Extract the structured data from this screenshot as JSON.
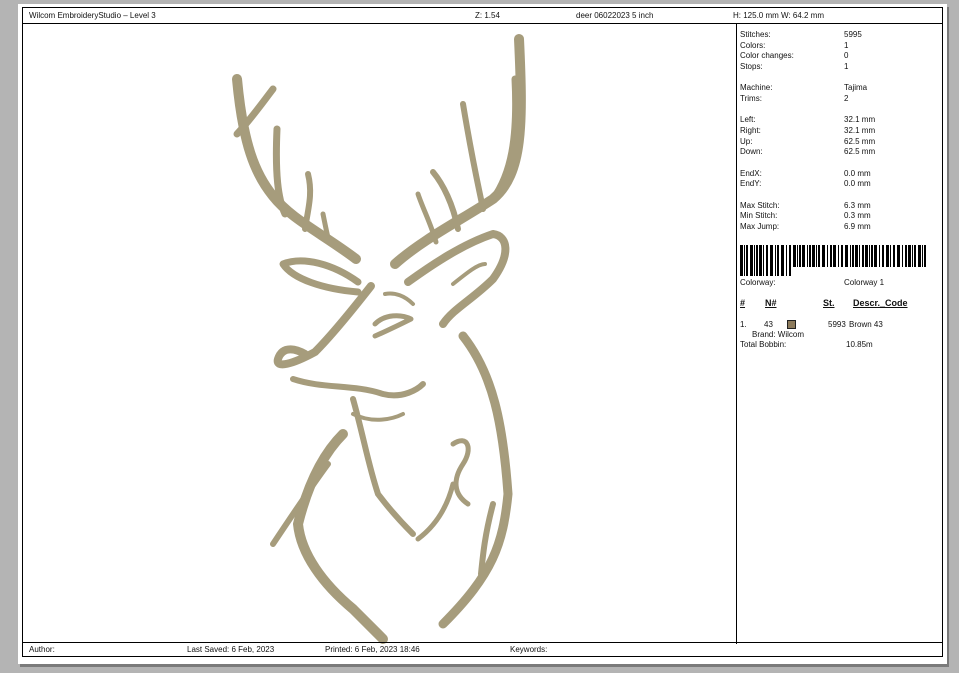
{
  "header": {
    "app_title": "Wilcom EmbroideryStudio – Level 3",
    "zoom": "Z: 1.54",
    "file_name": "deer 06022023 5 inch",
    "dimensions": "H: 125.0 mm   W: 64.2 mm"
  },
  "stats": {
    "stitches": {
      "label": "Stitches:",
      "value": "5995"
    },
    "colors": {
      "label": "Colors:",
      "value": "1"
    },
    "color_changes": {
      "label": "Color changes:",
      "value": "0"
    },
    "stops": {
      "label": "Stops:",
      "value": "1"
    },
    "machine": {
      "label": "Machine:",
      "value": "Tajima"
    },
    "trims": {
      "label": "Trims:",
      "value": "2"
    },
    "left": {
      "label": "Left:",
      "value": "32.1 mm"
    },
    "right": {
      "label": "Right:",
      "value": "32.1 mm"
    },
    "up": {
      "label": "Up:",
      "value": "62.5 mm"
    },
    "down": {
      "label": "Down:",
      "value": "62.5 mm"
    },
    "endx": {
      "label": "EndX:",
      "value": "0.0 mm"
    },
    "endy": {
      "label": "EndY:",
      "value": "0.0 mm"
    },
    "max_stitch": {
      "label": "Max Stitch:",
      "value": "6.3 mm"
    },
    "min_stitch": {
      "label": "Min Stitch:",
      "value": "0.3 mm"
    },
    "max_jump": {
      "label": "Max Jump:",
      "value": "6.9 mm"
    }
  },
  "colorway": {
    "label": "Colorway:",
    "value": "Colorway 1"
  },
  "color_table": {
    "headers": [
      "#",
      "N#",
      "St.",
      "Descr._Code"
    ],
    "rows": [
      {
        "index": "1.",
        "number": "43",
        "swatch_color": "#8c7a5b",
        "stitches": "5993",
        "description": "Brown 43",
        "brand": "Brand: Wilcom"
      }
    ]
  },
  "bobbin": {
    "label": "Total Bobbin:",
    "value": "10.85m"
  },
  "footer": {
    "author": "Author:",
    "last_saved": "Last Saved:  6 Feb, 2023",
    "printed": "Printed:  6 Feb, 2023 18:46",
    "keywords": "Keywords:"
  },
  "thread_color": "#a69c7c"
}
